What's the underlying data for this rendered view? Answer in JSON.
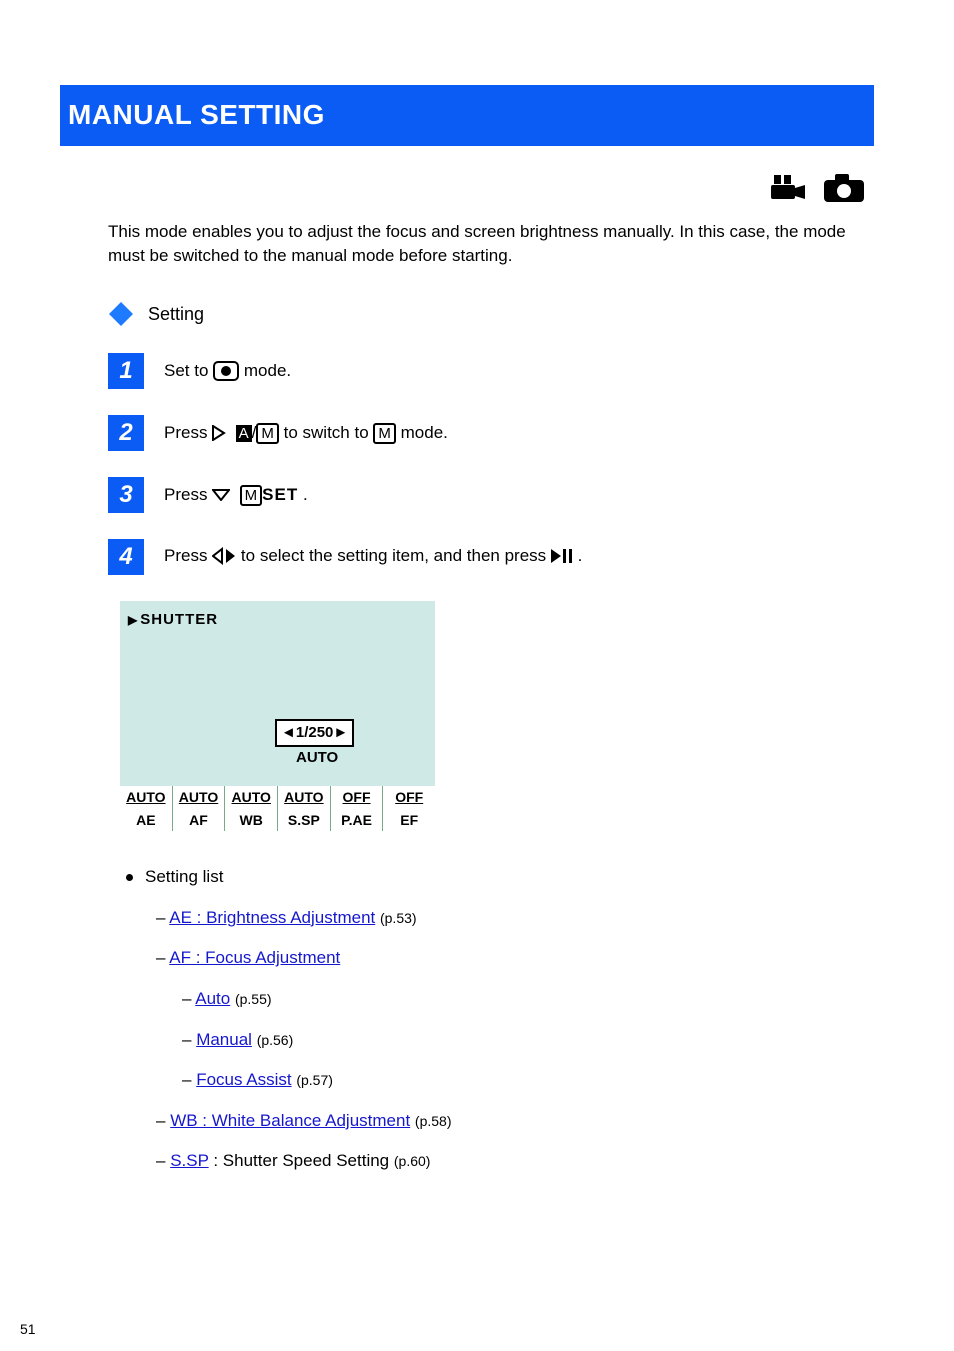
{
  "header": {
    "title": "MANUAL SETTING"
  },
  "intro": "This mode enables you to adjust the focus and screen brightness manually. In this case, the mode must be switched to the manual mode before starting.",
  "setting_label": "Setting",
  "steps": [
    {
      "n": "1",
      "pre": "Set to ",
      "icon": "record",
      "post": " mode."
    },
    {
      "n": "2",
      "icon_seq": "am_to_m",
      "pre": "Press ",
      "post": " to switch to ",
      "post2": " mode."
    },
    {
      "n": "3",
      "icon": "mset",
      "pre": "Press ",
      "post": "."
    },
    {
      "n": "4",
      "icon": "lr",
      "pre": "Press ",
      "mid": " to select the setting item, and then press ",
      "post": "."
    }
  ],
  "lcd": {
    "title": "SHUTTER",
    "value": "◄1/250►",
    "auto": "AUTO",
    "row1": [
      "AUTO",
      "AUTO",
      "AUTO",
      "AUTO",
      "OFF",
      "OFF"
    ],
    "row2": [
      "AE",
      "AF",
      "WB",
      "S.SP",
      "P.AE",
      "EF"
    ]
  },
  "links": {
    "label": "Setting list",
    "items": [
      {
        "text": "AE : Brightness Adjustment",
        "page": "(p.53)"
      },
      {
        "text": "AF : Focus Adjustment"
      },
      {
        "sub": [
          {
            "text": "Auto",
            "page": "(p.55)"
          },
          {
            "text": "Manual",
            "page": "(p.56)"
          },
          {
            "text": "Focus Assist",
            "page": "(p.57)"
          }
        ]
      },
      {
        "text": "WB : White Balance Adjustment",
        "page": "(p.58)"
      },
      {
        "text": "S.SP",
        "tail": " : Shutter Speed Setting",
        "page": "(p.60)"
      }
    ]
  },
  "page_number": "51"
}
